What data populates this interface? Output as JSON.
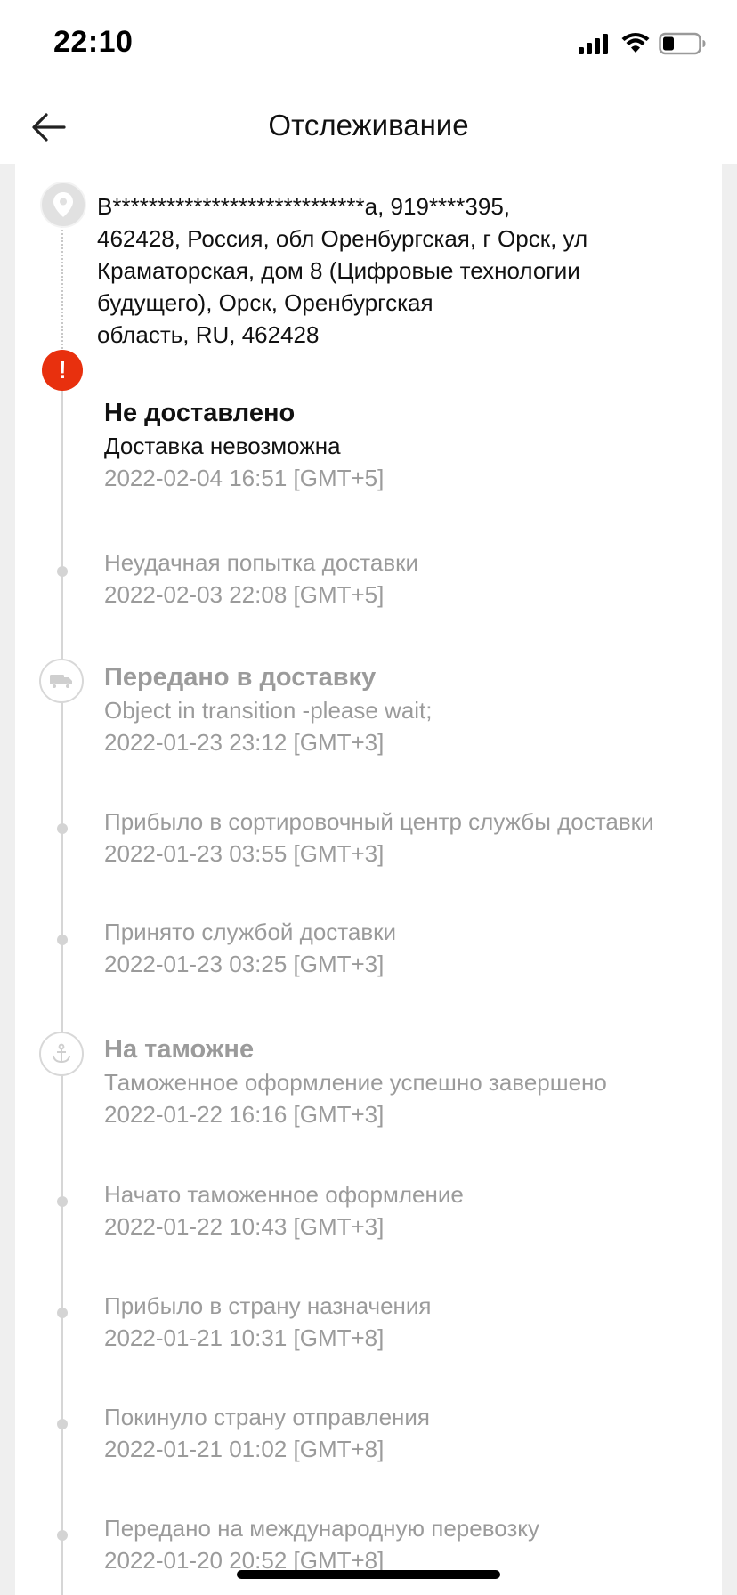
{
  "status_bar": {
    "time": "22:10"
  },
  "header": {
    "title": "Отслеживание"
  },
  "address": {
    "line1": "В****************************а,  919****395,",
    "line2": "462428,  Россия, обл Оренбургская, г Орск, ул",
    "line3": "Краматорская, дом 8 (Цифровые технологии",
    "line4": "будущего),  Орск,  Оренбургская",
    "line5": "область,  RU,  462428"
  },
  "events": [
    {
      "title": "Не доставлено",
      "desc": "Доставка невозможна",
      "time": "2022-02-04 16:51 [GMT+5]"
    },
    {
      "desc": "Неудачная попытка доставки",
      "time": "2022-02-03 22:08 [GMT+5]"
    },
    {
      "title": "Передано в доставку",
      "desc": "Object in transition -please wait;",
      "time": "2022-01-23 23:12 [GMT+3]"
    },
    {
      "desc": "Прибыло в сортировочный центр службы доставки",
      "time": "2022-01-23 03:55 [GMT+3]"
    },
    {
      "desc": "Принято службой доставки",
      "time": "2022-01-23 03:25 [GMT+3]"
    },
    {
      "title": "На таможне",
      "desc": "Таможенное оформление успешно завершено",
      "time": "2022-01-22 16:16 [GMT+3]"
    },
    {
      "desc": "Начато таможенное оформление",
      "time": "2022-01-22 10:43 [GMT+3]"
    },
    {
      "desc": "Прибыло в страну назначения",
      "time": "2022-01-21 10:31 [GMT+8]"
    },
    {
      "desc": "Покинуло страну отправления",
      "time": "2022-01-21 01:02 [GMT+8]"
    },
    {
      "desc": "Передано на международную перевозку",
      "time": "2022-01-20 20:52 [GMT+8]"
    }
  ],
  "colors": {
    "alert": "#e8300e",
    "muted": "#9b9b9b",
    "line": "#d6d6d6"
  },
  "icons": [
    "back-arrow-icon",
    "location-pin-icon",
    "alert-icon",
    "truck-icon",
    "anchor-icon",
    "signal-icon",
    "wifi-icon",
    "battery-icon"
  ]
}
